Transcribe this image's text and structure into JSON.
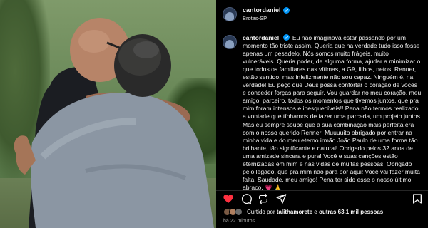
{
  "post": {
    "username": "cantordaniel",
    "location": "Brotas-SP",
    "caption": "Eu não imaginava estar passando por um momento tão triste assim. Queria que na verdade tudo isso fosse apenas um pesadelo. Nós somos muito frágeis, muito vulneráveis. Queria poder, de alguma forma, ajudar a minimizar o que todos os familiares das vítimas, a Gê, filhos, netos, Renner, estão sentido, mas infelizmente não sou capaz. Ninguém é, na verdade! Eu peço que Deus possa confortar o coração de vocês e conceder forças para seguir. Vou guardar no meu coração, meu amigo, parceiro, todos os momentos que tivemos juntos, que pra mim foram intensos e inesquecíveis!! Pena não termos realizado a vontade que tínhamos de fazer uma parceria, um projeto juntos. Mas eu sempre soube que a sua combinação mais perfeita era com o nosso querido Renner! Muuuuito obrigado por entrar na minha vida e do meu eterno irmão João Paulo de uma forma tão brilhante, tão significante e natural! Obrigado pelos 32 anos de uma amizade sincera e pura! Você e suas canções estão eternizadas em mim e nas vidas de muitas pessoas! Obrigado pelo legado, que pra mim não para por aqui! Você vai fazer muita falta! Saudade, meu amigo! Pena ter sido esse o nosso último abraço. 💗 🙏",
    "liked_prefix": "Curtido por",
    "liked_user": "talithamorete",
    "liked_connector": "e",
    "liked_others": "outras 63,1 mil pessoas",
    "time_ago": "há 22 minutos"
  },
  "icons": {
    "like": "heart-filled-icon",
    "comment": "comment-icon",
    "repost": "repost-icon",
    "share": "share-icon",
    "save": "bookmark-icon",
    "verified": "verified-badge-icon"
  },
  "colors": {
    "like": "#ff3040",
    "verified": "#0095f6",
    "background": "#000000",
    "muted_text": "#a8a8a8"
  }
}
